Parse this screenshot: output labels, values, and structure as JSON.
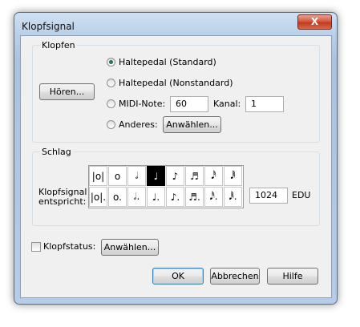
{
  "dialog": {
    "title": "Klopfsignal",
    "close_symbol": "X"
  },
  "klopfen": {
    "group_label": "Klopfen",
    "hoeren_label": "Hören...",
    "radio_standard": "Haltepedal (Standard)",
    "radio_nonstandard": "Haltepedal (Nonstandard)",
    "radio_midi": "MIDI-Note:",
    "midi_note_value": "60",
    "kanal_label": "Kanal:",
    "kanal_value": "1",
    "radio_anderes": "Anderes:",
    "anwaehlen_label": "Anwählen..."
  },
  "schlag": {
    "group_label": "Schlag",
    "klopfsignal_label_line1": "Klopfsignal",
    "klopfsignal_label_line2": "entspricht:",
    "notes_row1": [
      "|o|",
      "o",
      "𝅗𝅥",
      "♩",
      "♪",
      "♬",
      "𝅘𝅥𝅰",
      "𝅘𝅥𝅱"
    ],
    "notes_row2": [
      "|o|.",
      "o.",
      "𝅗𝅥.",
      "♩.",
      "♪.",
      "♬.",
      "𝅘𝅥𝅰.",
      "𝅘𝅥𝅱."
    ],
    "selected_index": 3,
    "edu_value": "1024",
    "edu_label": "EDU"
  },
  "klopfstatus": {
    "label": "Klopfstatus:",
    "anwaehlen_label": "Anwählen..."
  },
  "footer": {
    "ok_label": "OK",
    "abbrechen_label": "Abbrechen",
    "hilfe_label": "Hilfe"
  }
}
